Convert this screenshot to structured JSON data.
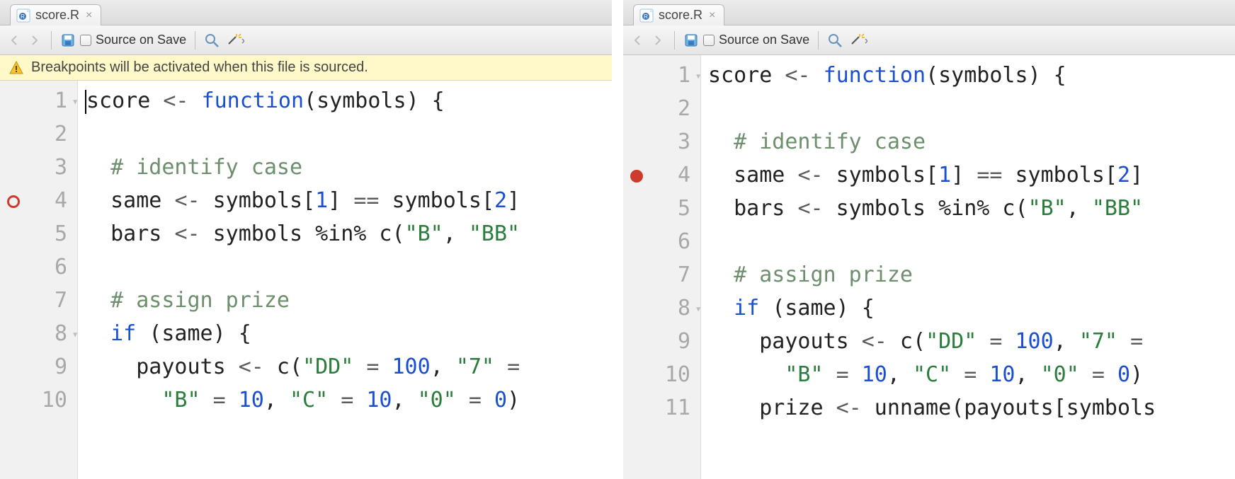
{
  "panes": [
    {
      "tab": {
        "label": "score.R"
      },
      "toolbar": {
        "source_on_save": "Source on Save"
      },
      "warning": {
        "text": "Breakpoints will be activated when this file is sourced."
      },
      "show_warning": true,
      "breakpoint": {
        "line": 4,
        "style": "hollow"
      },
      "fold_lines": [
        1,
        8
      ],
      "lines": [
        {
          "n": 1,
          "tokens": [
            [
              "cursor",
              ""
            ],
            [
              "id",
              "score "
            ],
            [
              "op",
              "<-"
            ],
            [
              "id",
              " "
            ],
            [
              "kw",
              "function"
            ],
            [
              "pun",
              "("
            ],
            [
              "id",
              "symbols"
            ],
            [
              "pun",
              ") {"
            ]
          ]
        },
        {
          "n": 2,
          "tokens": []
        },
        {
          "n": 3,
          "tokens": [
            [
              "id",
              "  "
            ],
            [
              "cmt",
              "# identify case"
            ]
          ]
        },
        {
          "n": 4,
          "tokens": [
            [
              "id",
              "  same "
            ],
            [
              "op",
              "<-"
            ],
            [
              "id",
              " symbols"
            ],
            [
              "pun",
              "["
            ],
            [
              "num",
              "1"
            ],
            [
              "pun",
              "]"
            ],
            [
              "id",
              " "
            ],
            [
              "op",
              "=="
            ],
            [
              "id",
              " symbols"
            ],
            [
              "pun",
              "["
            ],
            [
              "num",
              "2"
            ],
            [
              "pun",
              "]"
            ]
          ]
        },
        {
          "n": 5,
          "tokens": [
            [
              "id",
              "  bars "
            ],
            [
              "op",
              "<-"
            ],
            [
              "id",
              " symbols %in% c"
            ],
            [
              "pun",
              "("
            ],
            [
              "str",
              "\"B\""
            ],
            [
              "pun",
              ", "
            ],
            [
              "str",
              "\"BB\""
            ]
          ]
        },
        {
          "n": 6,
          "tokens": []
        },
        {
          "n": 7,
          "tokens": [
            [
              "id",
              "  "
            ],
            [
              "cmt",
              "# assign prize"
            ]
          ]
        },
        {
          "n": 8,
          "tokens": [
            [
              "id",
              "  "
            ],
            [
              "kw",
              "if"
            ],
            [
              "id",
              " "
            ],
            [
              "pun",
              "("
            ],
            [
              "id",
              "same"
            ],
            [
              "pun",
              ") {"
            ]
          ]
        },
        {
          "n": 9,
          "tokens": [
            [
              "id",
              "    payouts "
            ],
            [
              "op",
              "<-"
            ],
            [
              "id",
              " c"
            ],
            [
              "pun",
              "("
            ],
            [
              "str",
              "\"DD\""
            ],
            [
              "id",
              " "
            ],
            [
              "op",
              "="
            ],
            [
              "id",
              " "
            ],
            [
              "num",
              "100"
            ],
            [
              "pun",
              ", "
            ],
            [
              "str",
              "\"7\""
            ],
            [
              "id",
              " "
            ],
            [
              "op",
              "="
            ]
          ]
        },
        {
          "n": 10,
          "tokens": [
            [
              "id",
              "      "
            ],
            [
              "str",
              "\"B\""
            ],
            [
              "id",
              " "
            ],
            [
              "op",
              "="
            ],
            [
              "id",
              " "
            ],
            [
              "num",
              "10"
            ],
            [
              "pun",
              ", "
            ],
            [
              "str",
              "\"C\""
            ],
            [
              "id",
              " "
            ],
            [
              "op",
              "="
            ],
            [
              "id",
              " "
            ],
            [
              "num",
              "10"
            ],
            [
              "pun",
              ", "
            ],
            [
              "str",
              "\"0\""
            ],
            [
              "id",
              " "
            ],
            [
              "op",
              "="
            ],
            [
              "id",
              " "
            ],
            [
              "num",
              "0"
            ],
            [
              "pun",
              ")"
            ]
          ]
        }
      ]
    },
    {
      "tab": {
        "label": "score.R"
      },
      "toolbar": {
        "source_on_save": "Source on Save"
      },
      "show_warning": false,
      "breakpoint": {
        "line": 4,
        "style": "solid"
      },
      "fold_lines": [
        1,
        8
      ],
      "lines": [
        {
          "n": 1,
          "tokens": [
            [
              "id",
              "score "
            ],
            [
              "op",
              "<-"
            ],
            [
              "id",
              " "
            ],
            [
              "kw",
              "function"
            ],
            [
              "pun",
              "("
            ],
            [
              "id",
              "symbols"
            ],
            [
              "pun",
              ") {"
            ]
          ]
        },
        {
          "n": 2,
          "tokens": []
        },
        {
          "n": 3,
          "tokens": [
            [
              "id",
              "  "
            ],
            [
              "cmt",
              "# identify case"
            ]
          ]
        },
        {
          "n": 4,
          "tokens": [
            [
              "id",
              "  same "
            ],
            [
              "op",
              "<-"
            ],
            [
              "id",
              " symbols"
            ],
            [
              "pun",
              "["
            ],
            [
              "num",
              "1"
            ],
            [
              "pun",
              "]"
            ],
            [
              "id",
              " "
            ],
            [
              "op",
              "=="
            ],
            [
              "id",
              " symbols"
            ],
            [
              "pun",
              "["
            ],
            [
              "num",
              "2"
            ],
            [
              "pun",
              "]"
            ]
          ]
        },
        {
          "n": 5,
          "tokens": [
            [
              "id",
              "  bars "
            ],
            [
              "op",
              "<-"
            ],
            [
              "id",
              " symbols %in% c"
            ],
            [
              "pun",
              "("
            ],
            [
              "str",
              "\"B\""
            ],
            [
              "pun",
              ", "
            ],
            [
              "str",
              "\"BB\""
            ]
          ]
        },
        {
          "n": 6,
          "tokens": []
        },
        {
          "n": 7,
          "tokens": [
            [
              "id",
              "  "
            ],
            [
              "cmt",
              "# assign prize"
            ]
          ]
        },
        {
          "n": 8,
          "tokens": [
            [
              "id",
              "  "
            ],
            [
              "kw",
              "if"
            ],
            [
              "id",
              " "
            ],
            [
              "pun",
              "("
            ],
            [
              "id",
              "same"
            ],
            [
              "pun",
              ") {"
            ]
          ]
        },
        {
          "n": 9,
          "tokens": [
            [
              "id",
              "    payouts "
            ],
            [
              "op",
              "<-"
            ],
            [
              "id",
              " c"
            ],
            [
              "pun",
              "("
            ],
            [
              "str",
              "\"DD\""
            ],
            [
              "id",
              " "
            ],
            [
              "op",
              "="
            ],
            [
              "id",
              " "
            ],
            [
              "num",
              "100"
            ],
            [
              "pun",
              ", "
            ],
            [
              "str",
              "\"7\""
            ],
            [
              "id",
              " "
            ],
            [
              "op",
              "="
            ]
          ]
        },
        {
          "n": 10,
          "tokens": [
            [
              "id",
              "      "
            ],
            [
              "str",
              "\"B\""
            ],
            [
              "id",
              " "
            ],
            [
              "op",
              "="
            ],
            [
              "id",
              " "
            ],
            [
              "num",
              "10"
            ],
            [
              "pun",
              ", "
            ],
            [
              "str",
              "\"C\""
            ],
            [
              "id",
              " "
            ],
            [
              "op",
              "="
            ],
            [
              "id",
              " "
            ],
            [
              "num",
              "10"
            ],
            [
              "pun",
              ", "
            ],
            [
              "str",
              "\"0\""
            ],
            [
              "id",
              " "
            ],
            [
              "op",
              "="
            ],
            [
              "id",
              " "
            ],
            [
              "num",
              "0"
            ],
            [
              "pun",
              ")"
            ]
          ]
        },
        {
          "n": 11,
          "tokens": [
            [
              "id",
              "    prize "
            ],
            [
              "op",
              "<-"
            ],
            [
              "id",
              " unname"
            ],
            [
              "pun",
              "("
            ],
            [
              "id",
              "payouts"
            ],
            [
              "pun",
              "["
            ],
            [
              "id",
              "symbols"
            ]
          ]
        }
      ]
    }
  ]
}
